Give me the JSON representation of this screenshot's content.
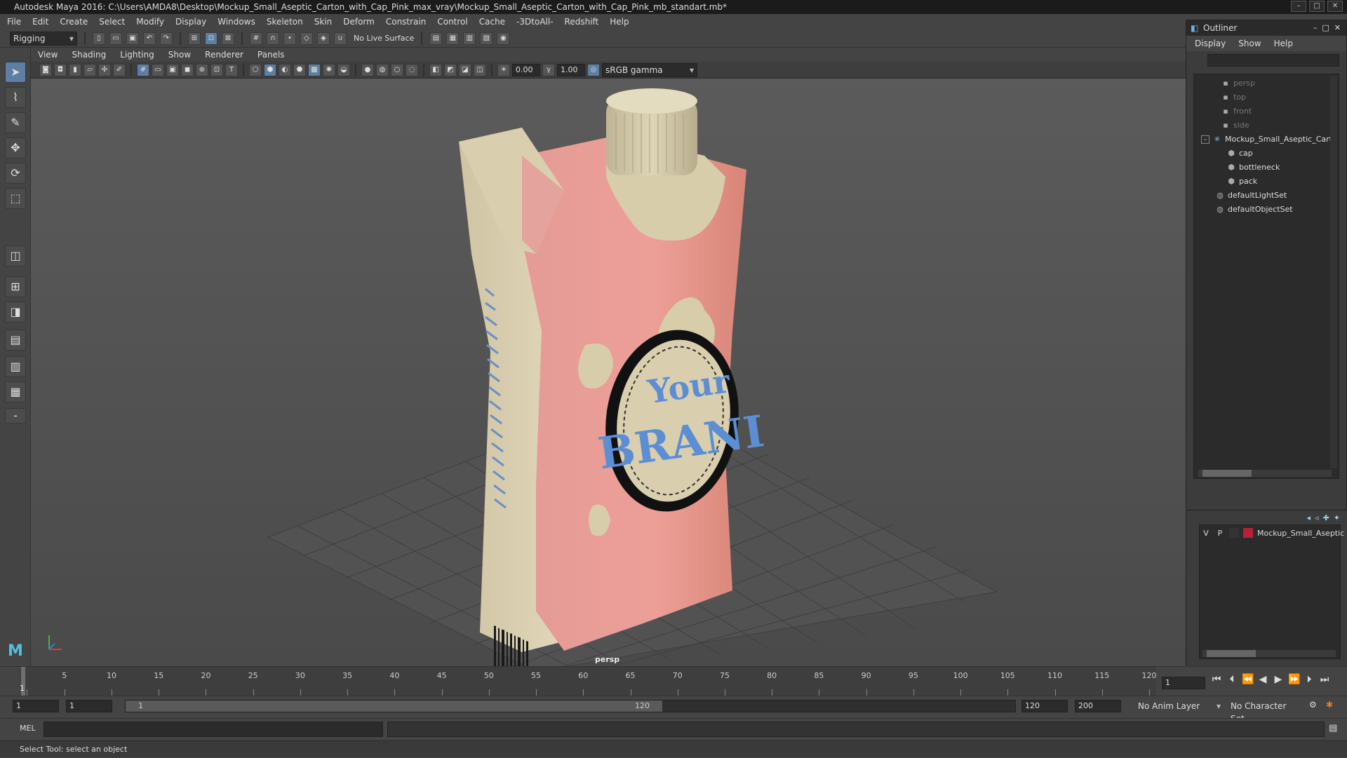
{
  "window": {
    "title": "Autodesk Maya 2016: C:\\Users\\AMDA8\\Desktop\\Mockup_Small_Aseptic_Carton_with_Cap_Pink_max_vray\\Mockup_Small_Aseptic_Carton_with_Cap_Pink_mb_standart.mb*"
  },
  "menubar": [
    "File",
    "Edit",
    "Create",
    "Select",
    "Modify",
    "Display",
    "Windows",
    "Skeleton",
    "Skin",
    "Deform",
    "Constrain",
    "Control",
    "Cache",
    "-3DtoAll-",
    "Redshift",
    "Help"
  ],
  "statusline": {
    "mode": "Rigging",
    "live_surface": "No Live Surface"
  },
  "panel": {
    "menu": [
      "View",
      "Shading",
      "Lighting",
      "Show",
      "Renderer",
      "Panels"
    ],
    "exposure": "0.00",
    "gamma": "1.00",
    "colorspace": "sRGB gamma",
    "camera_label": "persp"
  },
  "icons": {
    "select_tool": "arrow-icon",
    "lasso_tool": "lasso-icon",
    "paint_tool": "brush-icon",
    "move_tool": "move-icon",
    "rotate_tool": "rotate-icon",
    "scale_tool": "scale-icon"
  },
  "carton": {
    "brand_line1": "Your",
    "brand_line2": "BRANI",
    "colors": {
      "pink": "#e9a4a0",
      "cream": "#d8cdaa",
      "blue": "#5c8ed4"
    }
  },
  "outliner": {
    "title": "Outliner",
    "menu": [
      "Display",
      "Show",
      "Help"
    ],
    "items": [
      {
        "label": "persp",
        "dim": true
      },
      {
        "label": "top",
        "dim": true
      },
      {
        "label": "front",
        "dim": true
      },
      {
        "label": "side",
        "dim": true
      },
      {
        "label": "Mockup_Small_Aseptic_Cart",
        "dim": false
      },
      {
        "label": "cap",
        "dim": false
      },
      {
        "label": "bottleneck",
        "dim": false
      },
      {
        "label": "pack",
        "dim": false
      },
      {
        "label": "defaultLightSet",
        "dim": false
      },
      {
        "label": "defaultObjectSet",
        "dim": false
      }
    ]
  },
  "layers": {
    "v": "V",
    "p": "P",
    "name": "Mockup_Small_Aseptic",
    "color": "#b7203a"
  },
  "timeline": {
    "ticks": [
      "1",
      "5",
      "10",
      "15",
      "20",
      "25",
      "30",
      "35",
      "40",
      "45",
      "50",
      "55",
      "60",
      "65",
      "70",
      "75",
      "80",
      "85",
      "90",
      "95",
      "100",
      "105",
      "110",
      "115",
      "120"
    ],
    "current_frame": "1",
    "current_frame_field": "1"
  },
  "range": {
    "start": "1",
    "start_inner": "1",
    "slider_start": "1",
    "slider_end": "120",
    "end": "120",
    "end_outer": "200",
    "anim_layer": "No Anim Layer",
    "character_set": "No Character Set"
  },
  "command": {
    "language": "MEL"
  },
  "help": {
    "text": "Select Tool: select an object"
  }
}
